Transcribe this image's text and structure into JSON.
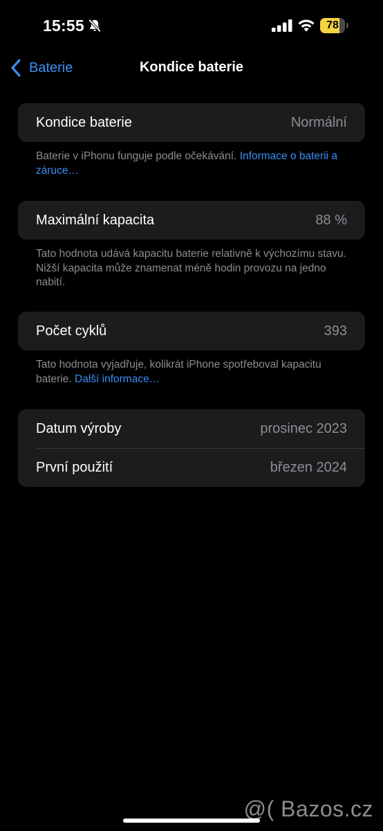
{
  "status_bar": {
    "time": "15:55",
    "battery_percent": "78",
    "battery_level": 0.78,
    "icons": [
      "bell-slash-icon",
      "cellular-signal-icon",
      "wifi-icon",
      "battery-icon"
    ]
  },
  "nav": {
    "back_label": "Baterie",
    "title": "Kondice baterie"
  },
  "groups": [
    {
      "rows": [
        {
          "label": "Kondice baterie",
          "value": "Normální"
        }
      ],
      "footer_text": "Baterie v iPhonu funguje podle očekávání. ",
      "footer_link": "Informace o baterii a záruce…"
    },
    {
      "rows": [
        {
          "label": "Maximální kapacita",
          "value": "88 %"
        }
      ],
      "footer_text": "Tato hodnota udává kapacitu baterie relativně k výchozímu stavu. Nižší kapacita může znamenat méně hodin provozu na jedno nabití."
    },
    {
      "rows": [
        {
          "label": "Počet cyklů",
          "value": "393"
        }
      ],
      "footer_text": "Tato hodnota vyjadřuje, kolikrát iPhone spotřeboval kapacitu baterie. ",
      "footer_link": "Další informace…"
    },
    {
      "rows": [
        {
          "label": "Datum výroby",
          "value": "prosinec 2023"
        },
        {
          "label": "První použití",
          "value": "březen 2024"
        }
      ]
    }
  ],
  "watermark": "@( Bazos.cz",
  "colors": {
    "background": "#000000",
    "cell": "#1c1c1e",
    "accent": "#3a8ef6",
    "secondary_text": "#8e8e93",
    "battery": "#f6d33d"
  }
}
